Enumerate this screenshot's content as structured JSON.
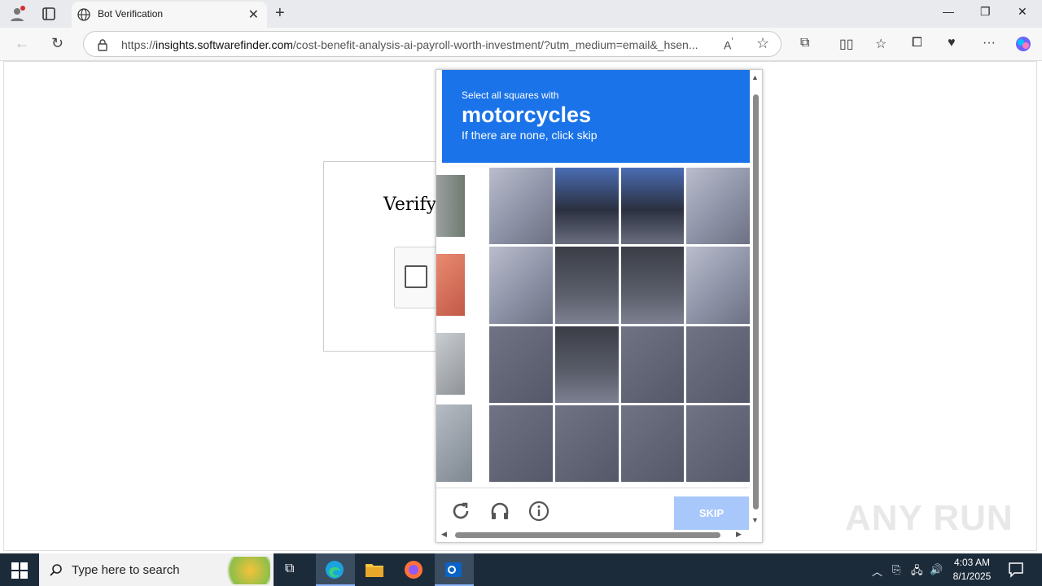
{
  "browser": {
    "tab_title": "Bot Verification",
    "url_prefix": "https://",
    "url_domain": "insights.softwarefinder.com",
    "url_path": "/cost-benefit-analysis-ai-payroll-worth-investment/?utm_medium=email&_hsen..."
  },
  "page": {
    "verify_title": "Verify"
  },
  "captcha": {
    "instruction_small": "Select all squares with",
    "target": "motorcycles",
    "instruction_sub": "If there are none, click skip",
    "skip_label": "SKIP"
  },
  "watermark": "ANY RUN",
  "taskbar": {
    "search_placeholder": "Type here to search",
    "time": "4:03 AM",
    "date": "8/1/2025"
  }
}
